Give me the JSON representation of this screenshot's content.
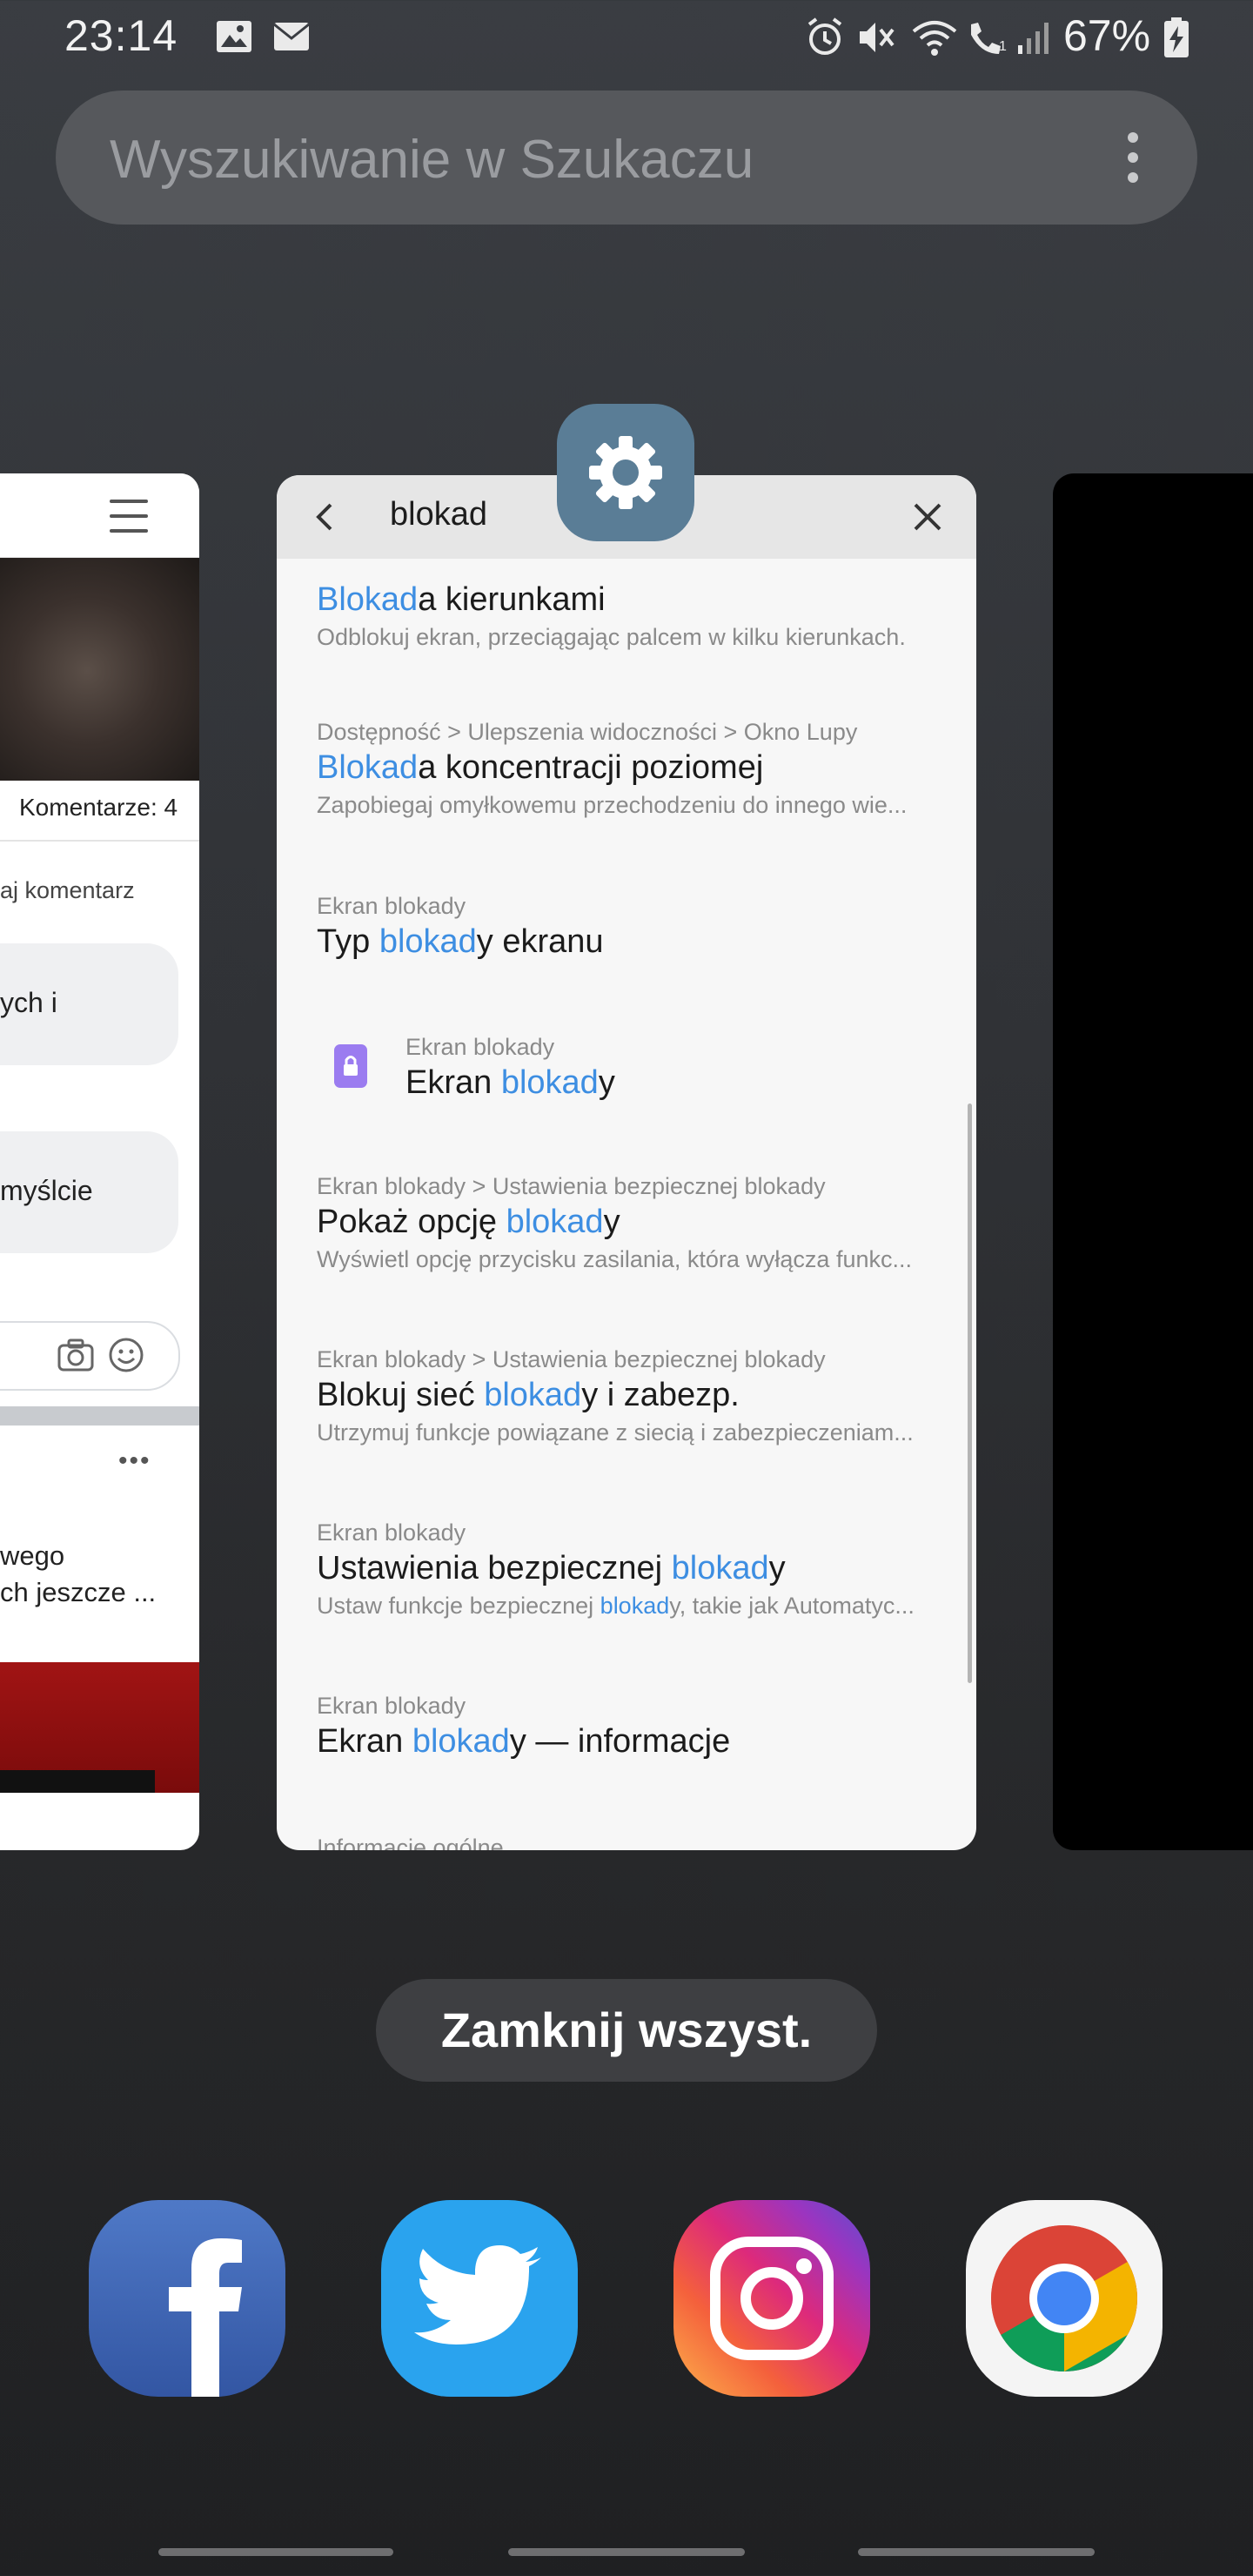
{
  "status_bar": {
    "time": "23:14",
    "battery": "67%",
    "icons": [
      "gallery-icon",
      "mail-icon",
      "alarm-icon",
      "mute-icon",
      "wifi-icon",
      "wifi-call-icon",
      "signal-icon",
      "battery-charging-icon"
    ]
  },
  "search": {
    "placeholder": "Wyszukiwanie w Szukaczu",
    "menu_icon": "more-vert-icon"
  },
  "left_card": {
    "comments": "Komentarze: 4",
    "add_comment": "aj komentarz",
    "bubble1": "ych i",
    "bubble2": "myślcie",
    "post_line1": "wego",
    "post_line2": "ch jeszcze ...",
    "more": "•••"
  },
  "settings_card": {
    "query": "blokad",
    "results": [
      {
        "path": "",
        "title_pre": "",
        "title_hl": "Blokad",
        "title_post": "a kierunkami",
        "sub": "Odblokuj ekran, przeciągając palcem w kilku kierunkach."
      },
      {
        "path": "Dostępność > Ulepszenia widoczności > Okno Lupy",
        "title_pre": "",
        "title_hl": "Blokad",
        "title_post": "a koncentracji poziomej",
        "sub": "Zapobiegaj omyłkowemu przechodzeniu do innego wie..."
      },
      {
        "path": "Ekran blokady",
        "title_pre": "Typ ",
        "title_hl": "blokad",
        "title_post": "y ekranu",
        "sub": ""
      },
      {
        "path": "Ekran blokady",
        "title_pre": "Ekran ",
        "title_hl": "blokad",
        "title_post": "y",
        "sub": ""
      },
      {
        "path": "Ekran blokady > Ustawienia bezpiecznej blokady",
        "title_pre": "Pokaż opcję ",
        "title_hl": "blokad",
        "title_post": "y",
        "sub": "Wyświetl opcję przycisku zasilania, która wyłącza funkc..."
      },
      {
        "path": "Ekran blokady > Ustawienia bezpiecznej blokady",
        "title_pre": "Blokuj sieć ",
        "title_hl": "blokad",
        "title_post": "y i zabezp.",
        "sub": "Utrzymuj funkcje powiązane z siecią i zabezpieczeniam..."
      },
      {
        "path": "Ekran blokady",
        "title_pre": "Ustawienia bezpiecznej ",
        "title_hl": "blokad",
        "title_post": "y",
        "sub_pre": "Ustaw funkcje bezpiecznej ",
        "sub_hl": "blokad",
        "sub_post": "y, takie jak Automatyc..."
      },
      {
        "path": "Ekran blokady",
        "title_pre": "Ekran ",
        "title_hl": "blokad",
        "title_post": "y — informacje",
        "sub": ""
      }
    ],
    "partial_next": "Informacje ogólne"
  },
  "close_all": "Zamknij wszyst.",
  "dock": [
    "Facebook",
    "Twitter",
    "Instagram",
    "Chrome"
  ],
  "colors": {
    "highlight": "#3d8ee2",
    "settings_badge": "#5a7d96"
  }
}
